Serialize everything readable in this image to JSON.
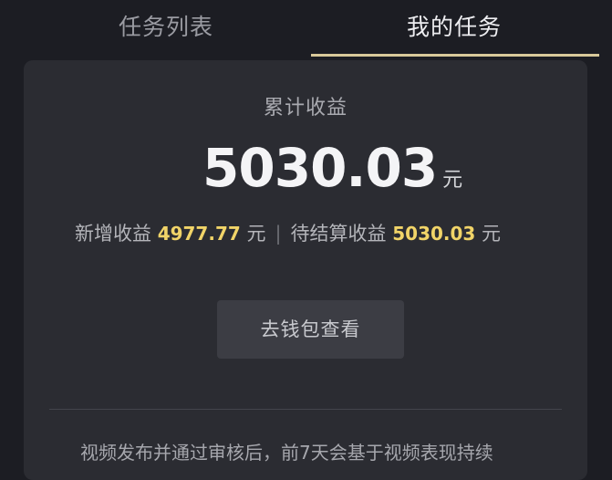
{
  "tabs": {
    "task_list": "任务列表",
    "my_tasks": "我的任务"
  },
  "earnings": {
    "title": "累计收益",
    "total": "5030.03",
    "unit": "元",
    "new_label": "新增收益",
    "new_value": "4977.77",
    "new_unit": "元",
    "separator": "|",
    "pending_label": "待结算收益",
    "pending_value": "5030.03",
    "pending_unit": "元"
  },
  "wallet_button": "去钱包查看",
  "notice": "视频发布并通过审核后，前7天会基于视频表现持续",
  "colors": {
    "accent": "#f1d468",
    "tab_underline": "#d8c99a",
    "background": "#1c1d23",
    "card": "#2b2c32"
  }
}
